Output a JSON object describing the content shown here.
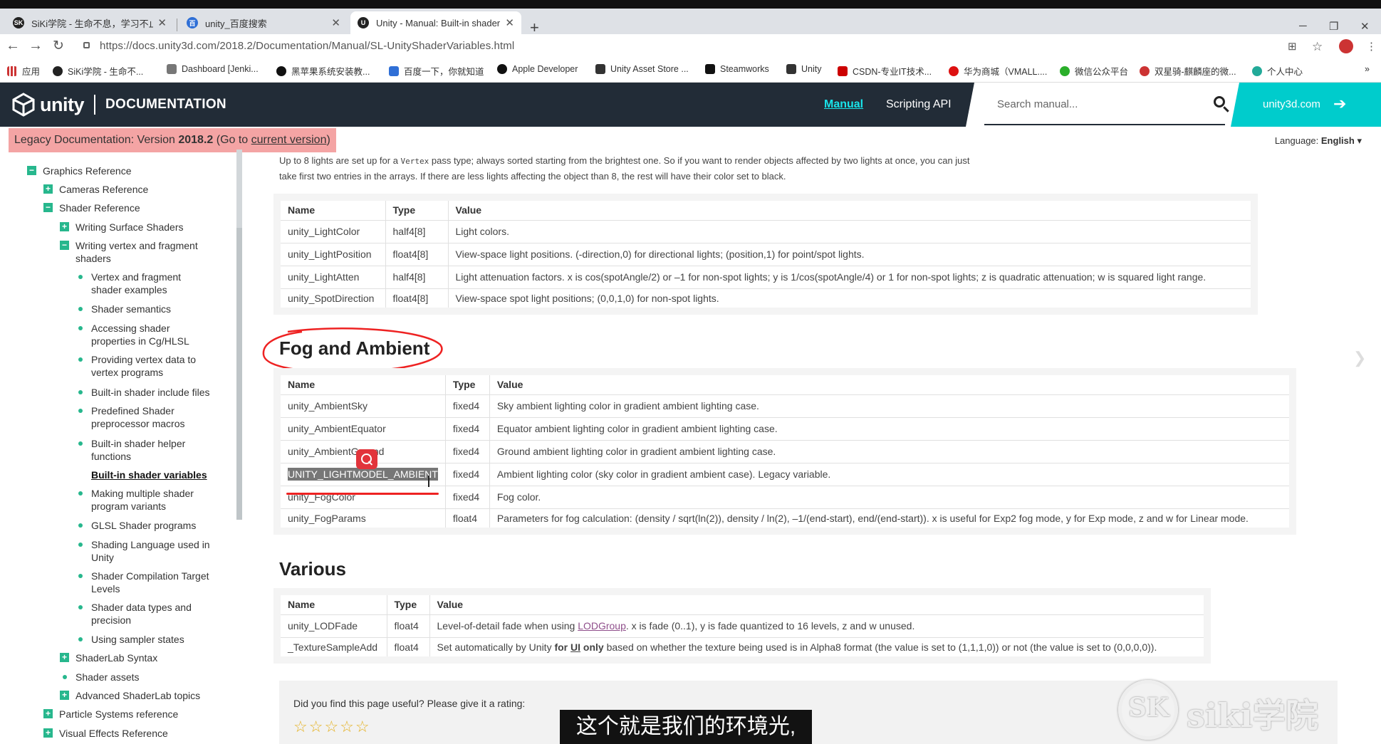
{
  "browser": {
    "tabs": [
      {
        "title": "SiKi学院 - 生命不息，学习不止!",
        "fav": "SK",
        "fav_color": "#222"
      },
      {
        "title": "unity_百度搜索",
        "fav": "百",
        "fav_color": "#2f6fd6"
      },
      {
        "title": "Unity - Manual: Built-in shader",
        "fav": "U",
        "fav_color": "#222"
      }
    ],
    "url": "https://docs.unity3d.com/2018.2/Documentation/Manual/SL-UnityShaderVariables.html",
    "bookmarks": [
      "应用",
      "SiKi学院 - 生命不...",
      "Dashboard [Jenki...",
      "黑苹果系统安装教...",
      "百度一下，你就知道",
      "Apple Developer",
      "Unity Asset Store ...",
      "Steamworks",
      "Unity",
      "CSDN-专业IT技术...",
      "华为商城（VMALL....",
      "微信公众平台",
      "双星骑-麒麟座的微...",
      "个人中心"
    ]
  },
  "header": {
    "logo": "unity",
    "section": "DOCUMENTATION",
    "nav_manual": "Manual",
    "nav_scripting": "Scripting API",
    "search_placeholder": "Search manual...",
    "site_link": "unity3d.com"
  },
  "legacy": {
    "prefix": "Legacy Documentation: Version ",
    "version": "2018.2",
    "goto": " (Go to ",
    "link": "current version",
    "suffix": ")"
  },
  "language": {
    "label": "Language:",
    "value": "English"
  },
  "sidebar": {
    "items": [
      {
        "label": "Graphics Reference",
        "kind": "minus"
      },
      {
        "label": "Cameras Reference",
        "kind": "plus"
      },
      {
        "label": "Shader Reference",
        "kind": "minus"
      },
      {
        "label": "Writing Surface Shaders",
        "kind": "plus"
      },
      {
        "label": "Writing vertex and fragment",
        "label2": "shaders",
        "kind": "minus"
      },
      {
        "label": "Vertex and fragment",
        "label2": "shader examples",
        "kind": "dot"
      },
      {
        "label": "Shader semantics",
        "kind": "dot"
      },
      {
        "label": "Accessing shader",
        "label2": "properties in Cg/HLSL",
        "kind": "dot"
      },
      {
        "label": "Providing vertex data to",
        "label2": "vertex programs",
        "kind": "dot"
      },
      {
        "label": "Built-in shader include files",
        "kind": "dot"
      },
      {
        "label": "Predefined Shader",
        "label2": "preprocessor macros",
        "kind": "dot"
      },
      {
        "label": "Built-in shader helper",
        "label2": "functions",
        "kind": "dot"
      },
      {
        "label": "Built-in shader variables",
        "kind": "selected"
      },
      {
        "label": "Making multiple shader",
        "label2": "program variants",
        "kind": "dot"
      },
      {
        "label": "GLSL Shader programs",
        "kind": "dot"
      },
      {
        "label": "Shading Language used in",
        "label2": "Unity",
        "kind": "dot"
      },
      {
        "label": "Shader Compilation Target",
        "label2": "Levels",
        "kind": "dot"
      },
      {
        "label": "Shader data types and",
        "label2": "precision",
        "kind": "dot"
      },
      {
        "label": "Using sampler states",
        "kind": "dot"
      },
      {
        "label": "ShaderLab Syntax",
        "kind": "plus"
      },
      {
        "label": "Shader assets",
        "kind": "dot"
      },
      {
        "label": "Advanced ShaderLab topics",
        "kind": "plus"
      },
      {
        "label": "Particle Systems reference",
        "kind": "plus"
      },
      {
        "label": "Visual Effects Reference",
        "kind": "plus"
      }
    ]
  },
  "intro": {
    "line1a": "Up to 8 lights are set up for a ",
    "line1code": "Vertex",
    "line1b": " pass type; always sorted starting from the brightest one. So if you want to render objects affected by two lights at once, you can just",
    "line2": "take first two entries in the arrays. If there are less lights affecting the object than 8, the rest will have their color set to black."
  },
  "lights_table": {
    "headers": [
      "Name",
      "Type",
      "Value"
    ],
    "rows": [
      [
        "unity_LightColor",
        "half4[8]",
        "Light colors."
      ],
      [
        "unity_LightPosition",
        "float4[8]",
        "View-space light positions. (-direction,0) for directional lights; (position,1) for point/spot lights."
      ],
      [
        "unity_LightAtten",
        "half4[8]",
        "Light attenuation factors. x is cos(spotAngle/2) or –1 for non-spot lights; y is 1/cos(spotAngle/4) or 1 for non-spot lights; z is quadratic attenuation; w is squared light range."
      ],
      [
        "unity_SpotDirection",
        "float4[8]",
        "View-space spot light positions; (0,0,1,0) for non-spot lights."
      ]
    ]
  },
  "fog": {
    "heading": "Fog and Ambient",
    "headers": [
      "Name",
      "Type",
      "Value"
    ],
    "rows": [
      [
        "unity_AmbientSky",
        "fixed4",
        "Sky ambient lighting color in gradient ambient lighting case."
      ],
      [
        "unity_AmbientEquator",
        "fixed4",
        "Equator ambient lighting color in gradient ambient lighting case."
      ],
      [
        "unity_AmbientGround",
        "fixed4",
        "Ground ambient lighting color in gradient ambient lighting case."
      ],
      [
        "UNITY_LIGHTMODEL_AMBIENT",
        "fixed4",
        "Ambient lighting color (sky color in gradient ambient case). Legacy variable."
      ],
      [
        "unity_FogColor",
        "fixed4",
        "Fog color."
      ],
      [
        "unity_FogParams",
        "float4",
        "Parameters for fog calculation: (density / sqrt(ln(2)), density / ln(2), –1/(end-start), end/(end-start)). x is useful for Exp2 fog mode, y for Exp mode, z and w for Linear mode."
      ]
    ]
  },
  "various": {
    "heading": "Various",
    "headers": [
      "Name",
      "Type",
      "Value"
    ],
    "row1": {
      "name": "unity_LODFade",
      "type": "float4",
      "pre": "Level-of-detail fade when using ",
      "link": "LODGroup",
      "post": ". x is fade (0..1), y is fade quantized to 16 levels, z and w unused."
    },
    "row2": {
      "name": "_TextureSampleAdd",
      "type": "float4",
      "pre": "Set automatically by Unity ",
      "b1": "for ",
      "b2": "UI",
      "b3": " only",
      "post": " based on whether the texture being used is in Alpha8 format (the value is set to (1,1,1,0)) or not (the value is set to (0,0,0,0))."
    }
  },
  "rating": {
    "question": "Did you find this page useful? Please give it a rating:",
    "stars": "☆☆☆☆☆"
  },
  "overlay": {
    "subtitle": "这个就是我们的环境光,",
    "watermark": "siki学院",
    "watermark_logo": "SK"
  }
}
